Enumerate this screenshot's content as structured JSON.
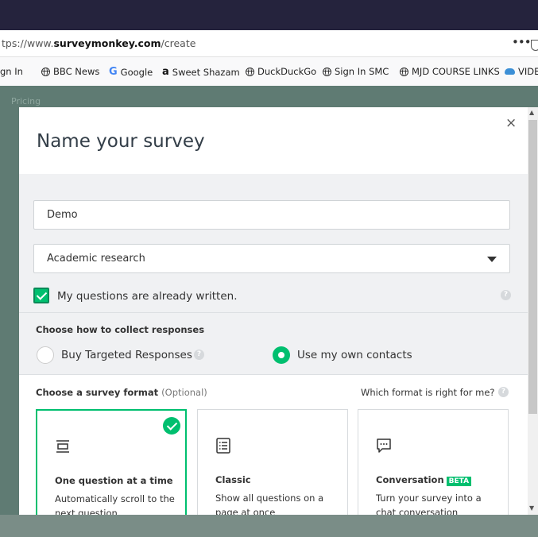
{
  "browser": {
    "url_prefix": "tps://www.",
    "url_domain": "surveymonkey.com",
    "url_path": "/create",
    "more_label": "•••"
  },
  "bookmarks": [
    {
      "label": "gn In"
    },
    {
      "label": "BBC News",
      "icon": "globe-icon"
    },
    {
      "label": "Google",
      "icon": "google-icon",
      "glyph": "G"
    },
    {
      "label": "Sweet Shazam",
      "icon": "amazon-icon",
      "glyph": "a"
    },
    {
      "label": "DuckDuckGo",
      "icon": "globe-icon"
    },
    {
      "label": "Sign In SMC",
      "icon": "globe-icon"
    },
    {
      "label": "MJD COURSE LINKS",
      "icon": "globe-icon"
    },
    {
      "label": "VIDE",
      "icon": "cloud-icon"
    }
  ],
  "backdrop": {
    "pricing": "Pricing"
  },
  "modal": {
    "title": "Name your survey",
    "close_label": "×",
    "survey_name_value": "Demo",
    "category_value": "Academic research",
    "questions_written_label": "My questions are already written.",
    "questions_written_checked": true,
    "collect_heading": "Choose how to collect responses",
    "collect_options": [
      {
        "label": "Buy Targeted Responses",
        "selected": false
      },
      {
        "label": "Use my own contacts",
        "selected": true
      }
    ],
    "format_heading": "Choose a survey format",
    "format_optional": "(Optional)",
    "format_help_link": "Which format is right for me?",
    "help_glyph": "?",
    "formats": [
      {
        "title": "One question at a time",
        "desc": "Automatically scroll to the next question",
        "selected": true,
        "icon": "one-question-icon"
      },
      {
        "title": "Classic",
        "desc": "Show all questions on a page at once",
        "selected": false,
        "icon": "list-icon"
      },
      {
        "title": "Conversation",
        "badge": "BETA",
        "desc": "Turn your survey into a chat conversation",
        "selected": false,
        "icon": "chat-icon"
      }
    ]
  },
  "scrollbar": {
    "up_glyph": "▲",
    "down_glyph": "▼"
  },
  "colors": {
    "accent": "#00bf6f",
    "backdrop": "#5f7b73",
    "topbar": "#25233d"
  }
}
